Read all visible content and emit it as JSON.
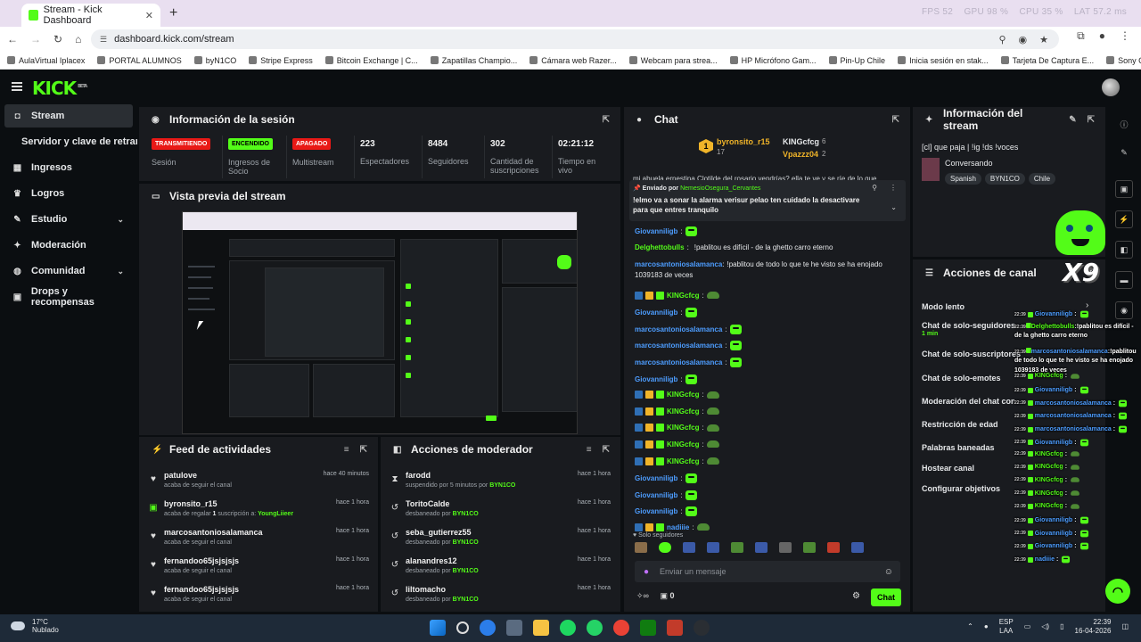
{
  "browser": {
    "tab_title": "Stream - Kick Dashboard",
    "url": "dashboard.kick.com/stream",
    "perf": {
      "fps_label": "FPS",
      "fps": "52",
      "gpu_label": "GPU",
      "gpu": "98 %",
      "cpu_label": "CPU",
      "cpu": "35 %",
      "lat_label": "LAT",
      "lat": "57.2 ms"
    },
    "bookmarks": [
      "AulaVirtual Iplacex",
      "PORTAL ALUMNOS",
      "byN1CO",
      "Stripe Express",
      "Bitcoin Exchange | C...",
      "Zapatillas Champio...",
      "Cámara web Razer...",
      "Webcam para strea...",
      "HP Micrófono Gam...",
      "Pin-Up Chile",
      "Inicia sesión en stak...",
      "Tarjeta De Captura E...",
      "Sony Consola PlaySt..."
    ]
  },
  "nav": {
    "logo": "KICK",
    "logo_sup": "BETA"
  },
  "sidebar": {
    "items": [
      {
        "label": "Stream",
        "icon": "video-icon"
      },
      {
        "label": "Servidor y clave de retransmisión"
      },
      {
        "label": "Ingresos",
        "icon": "money-icon"
      },
      {
        "label": "Logros",
        "icon": "trophy-icon"
      },
      {
        "label": "Estudio",
        "icon": "studio-icon"
      },
      {
        "label": "Moderación",
        "icon": "wrench-icon"
      },
      {
        "label": "Comunidad",
        "icon": "community-icon"
      },
      {
        "label": "Drops y recompensas",
        "icon": "gift-icon"
      }
    ]
  },
  "session": {
    "title": "Información de la sesión",
    "stats": [
      {
        "badge": "TRANSMITIENDO",
        "label": "Sesión"
      },
      {
        "badge": "ENCENDIDO",
        "label": "Ingresos de Socio"
      },
      {
        "badge": "APAGADO",
        "label": "Multistream"
      },
      {
        "value": "223",
        "label": "Espectadores"
      },
      {
        "value": "8484",
        "label": "Seguidores"
      },
      {
        "value": "302",
        "label": "Cantidad de suscripciones"
      },
      {
        "value": "02:21:12",
        "label": "Tiempo en vivo"
      }
    ]
  },
  "preview": {
    "title": "Vista previa del stream"
  },
  "feed": {
    "title": "Feed de actividades",
    "rows": [
      {
        "name": "patulove",
        "desc": "acaba de seguir el canal",
        "time": "hace 40 minutos",
        "icon": "heart-icon"
      },
      {
        "name": "byronsito_r15",
        "desc": "acaba de regalar",
        "desc_count": "1",
        "desc_mid": "suscripción a:",
        "desc_user": "YoungLiieer",
        "time": "hace 1 hora",
        "icon": "gift-icon"
      },
      {
        "name": "marcosantoniosalamanca",
        "desc": "acaba de seguir el canal",
        "time": "hace 1 hora",
        "icon": "heart-icon"
      },
      {
        "name": "fernandoo65jsjsjsjs",
        "desc": "acaba de seguir el canal",
        "time": "hace 1 hora",
        "icon": "heart-icon"
      },
      {
        "name": "fernandoo65jsjsjsjs",
        "desc": "acaba de seguir el canal",
        "time": "hace 1 hora",
        "icon": "heart-icon"
      }
    ]
  },
  "mod": {
    "title": "Acciones de moderador",
    "rows": [
      {
        "name": "farodd",
        "desc": "suspendido por 5 minutos por",
        "by": "BYN1CO",
        "time": "hace 1 hora",
        "icon": "hourglass-icon"
      },
      {
        "name": "ToritoCalde",
        "desc": "desbaneado por",
        "by": "BYN1CO",
        "time": "hace 1 hora",
        "icon": "undo-icon"
      },
      {
        "name": "seba_gutierrez55",
        "desc": "desbaneado por",
        "by": "BYN1CO",
        "time": "hace 1 hora",
        "icon": "undo-icon"
      },
      {
        "name": "alanandres12",
        "desc": "desbaneado por",
        "by": "BYN1CO",
        "time": "hace 1 hora",
        "icon": "undo-icon"
      },
      {
        "name": "liltomacho",
        "desc": "desbaneado por",
        "by": "BYN1CO",
        "time": "hace 1 hora",
        "icon": "undo-icon"
      }
    ]
  },
  "chat": {
    "title": "Chat",
    "top_gifter": {
      "rank": "1",
      "name": "byronsito_r15",
      "count": "17"
    },
    "top2": {
      "name": "KINGcfcg",
      "count": "6"
    },
    "top3": {
      "name": "Vpazzz04",
      "count": "2"
    },
    "truncated_line": "mi abuela ernestina Clotilde del rosario vendrías? ella te ve y se ríe de lo que",
    "pinned": {
      "by_label": "Enviado por",
      "by_user": "NemesioOsegura_Cervantes",
      "text": "!elmo va a sonar la alarma verisur pelao ten cuidado la desactivare para que entres tranquilo"
    },
    "messages": [
      {
        "user": "Giovanniligb",
        "color": "blue",
        "emote": true
      },
      {
        "user": "Delghettobulls",
        "color": "green",
        "text": "!pablitou es difícil - de la ghetto carro eterno"
      },
      {
        "user": "marcosantoniosalamanca",
        "color": "blue",
        "text": "!pablitou de todo lo que te he visto se ha enojado 1039183 de veces"
      },
      {
        "user": "KINGcfcg",
        "color": "green",
        "pepe": true,
        "badges": true
      },
      {
        "user": "Giovanniligb",
        "color": "blue",
        "emote": true
      },
      {
        "user": "marcosantoniosalamanca",
        "color": "blue",
        "emote": true
      },
      {
        "user": "marcosantoniosalamanca",
        "color": "blue",
        "emote": true
      },
      {
        "user": "marcosantoniosalamanca",
        "color": "blue",
        "emote": true
      },
      {
        "user": "Giovanniligb",
        "color": "blue",
        "emote": true
      },
      {
        "user": "KINGcfcg",
        "color": "green",
        "pepe": true,
        "badges": true
      },
      {
        "user": "KINGcfcg",
        "color": "green",
        "pepe": true,
        "badges": true
      },
      {
        "user": "KINGcfcg",
        "color": "green",
        "pepe": true,
        "badges": true
      },
      {
        "user": "KINGcfcg",
        "color": "green",
        "pepe": true,
        "badges": true
      },
      {
        "user": "KINGcfcg",
        "color": "green",
        "pepe": true,
        "badges": true
      },
      {
        "user": "Giovanniligb",
        "color": "blue",
        "emote": true
      },
      {
        "user": "Giovanniligb",
        "color": "blue",
        "emote": true
      },
      {
        "user": "Giovanniligb",
        "color": "blue",
        "emote": true
      },
      {
        "user": "nadiiie",
        "color": "blue",
        "pepe": true,
        "badges": true
      }
    ],
    "followers_only": "Solo seguidores",
    "input_placeholder": "Enviar un mensaje",
    "points": "0",
    "send_label": "Chat"
  },
  "stream_info": {
    "title": "Información del stream",
    "stream_title": "[cl] que paja | !ig !ds !voces",
    "category": "Conversando",
    "tags": [
      "Spanish",
      "BYN1CO",
      "Chile"
    ],
    "x9": "X9"
  },
  "channel_actions": {
    "title": "Acciones de canal",
    "items": [
      "Modo lento",
      "Chat de solo-seguidores",
      "Chat de solo-suscriptores",
      "Chat de solo-emotes",
      "Moderación del chat con IA",
      "Restricción de edad",
      "Palabras baneadas",
      "Hostear canal",
      "Configurar objetivos"
    ],
    "followers_duration": "1 min"
  },
  "overlay_chat": [
    {
      "time": "22:39",
      "user": "Giovanniligb",
      "color": "blue"
    },
    {
      "time": "22:39",
      "user": "Delghettobulls",
      "color": "green",
      "text": "!pablitou es difícil - de la ghetto carro eterno"
    },
    {
      "time": "22:39",
      "user": "marcosantoniosalamanca",
      "color": "blue",
      "text": "!pablitou de todo lo que te he visto se ha enojado 1039183 de veces"
    },
    {
      "time": "22:39",
      "user": "KINGcfcg",
      "color": "green"
    },
    {
      "time": "22:39",
      "user": "Giovanniligb",
      "color": "blue"
    },
    {
      "time": "22:39",
      "user": "marcosantoniosalamanca",
      "color": "blue"
    },
    {
      "time": "22:39",
      "user": "marcosantoniosalamanca",
      "color": "blue"
    },
    {
      "time": "22:39",
      "user": "marcosantoniosalamanca",
      "color": "blue"
    },
    {
      "time": "22:39",
      "user": "Giovanniligb",
      "color": "blue"
    },
    {
      "time": "22:39",
      "user": "KINGcfcg",
      "color": "green"
    },
    {
      "time": "22:39",
      "user": "KINGcfcg",
      "color": "green"
    },
    {
      "time": "22:39",
      "user": "KINGcfcg",
      "color": "green"
    },
    {
      "time": "22:39",
      "user": "KINGcfcg",
      "color": "green"
    },
    {
      "time": "22:39",
      "user": "KINGcfcg",
      "color": "green"
    },
    {
      "time": "22:39",
      "user": "Giovanniligb",
      "color": "blue"
    },
    {
      "time": "22:39",
      "user": "Giovanniligb",
      "color": "blue"
    },
    {
      "time": "22:39",
      "user": "Giovanniligb",
      "color": "blue"
    },
    {
      "time": "22:39",
      "user": "nadiiie",
      "color": "blue"
    }
  ],
  "taskbar": {
    "temp": "17°C",
    "weather": "Nublado",
    "lang": "ESP",
    "lang2": "LAA",
    "time": "22:39",
    "date": "16-04-2026"
  },
  "colors": {
    "accent": "#53fc18",
    "panel": "#191b1f",
    "bg": "#0b0e11",
    "live_red": "#e91916",
    "user_blue": "#4d9dff"
  }
}
